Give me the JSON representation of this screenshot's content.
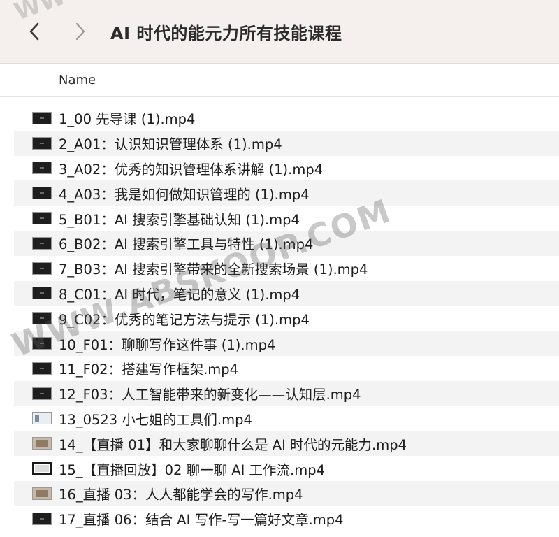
{
  "window": {
    "title": "AI 时代的能元力所有技能课程",
    "nav": {
      "back_icon": "chevron-left-icon",
      "forward_icon": "chevron-right-icon"
    }
  },
  "list_header": {
    "name_label": "Name"
  },
  "files": [
    {
      "name": "1_00 先导课 (1).mp4",
      "thumb": "dark"
    },
    {
      "name": "2_A01：认识知识管理体系 (1).mp4",
      "thumb": "dark"
    },
    {
      "name": "3_A02：优秀的知识管理体系讲解 (1).mp4",
      "thumb": "dark"
    },
    {
      "name": "4_A03：我是如何做知识管理的 (1).mp4",
      "thumb": "dark"
    },
    {
      "name": "5_B01：AI 搜索引擎基础认知 (1).mp4",
      "thumb": "dark"
    },
    {
      "name": "6_B02：AI 搜索引擎工具与特性 (1).mp4",
      "thumb": "dark"
    },
    {
      "name": "7_B03：AI 搜索引擎带来的全新搜索场景 (1).mp4",
      "thumb": "dark"
    },
    {
      "name": "8_C01：AI 时代，笔记的意义 (1).mp4",
      "thumb": "dark"
    },
    {
      "name": "9_C02：优秀的笔记方法与提示 (1).mp4",
      "thumb": "dark"
    },
    {
      "name": "10_F01：聊聊写作这件事 (1).mp4",
      "thumb": "dark"
    },
    {
      "name": "11_F02：搭建写作框架.mp4",
      "thumb": "dark"
    },
    {
      "name": "12_F03：人工智能带来的新变化——认知层.mp4",
      "thumb": "dark"
    },
    {
      "name": "13_0523 小七姐的工具们.mp4",
      "thumb": "light"
    },
    {
      "name": "14_【直播 01】和大家聊聊什么是 AI 时代的元能力.mp4",
      "thumb": "photo"
    },
    {
      "name": "15_【直播回放】02 聊一聊 AI 工作流.mp4",
      "thumb": "frame"
    },
    {
      "name": "16_直播 03：人人都能学会的写作.mp4",
      "thumb": "photo"
    },
    {
      "name": "17_直播 06：结合 AI 写作-写一篇好文章.mp4",
      "thumb": "dark"
    }
  ],
  "watermark": {
    "main": "WWW.ABSKOOP.COM",
    "top": "WW"
  }
}
